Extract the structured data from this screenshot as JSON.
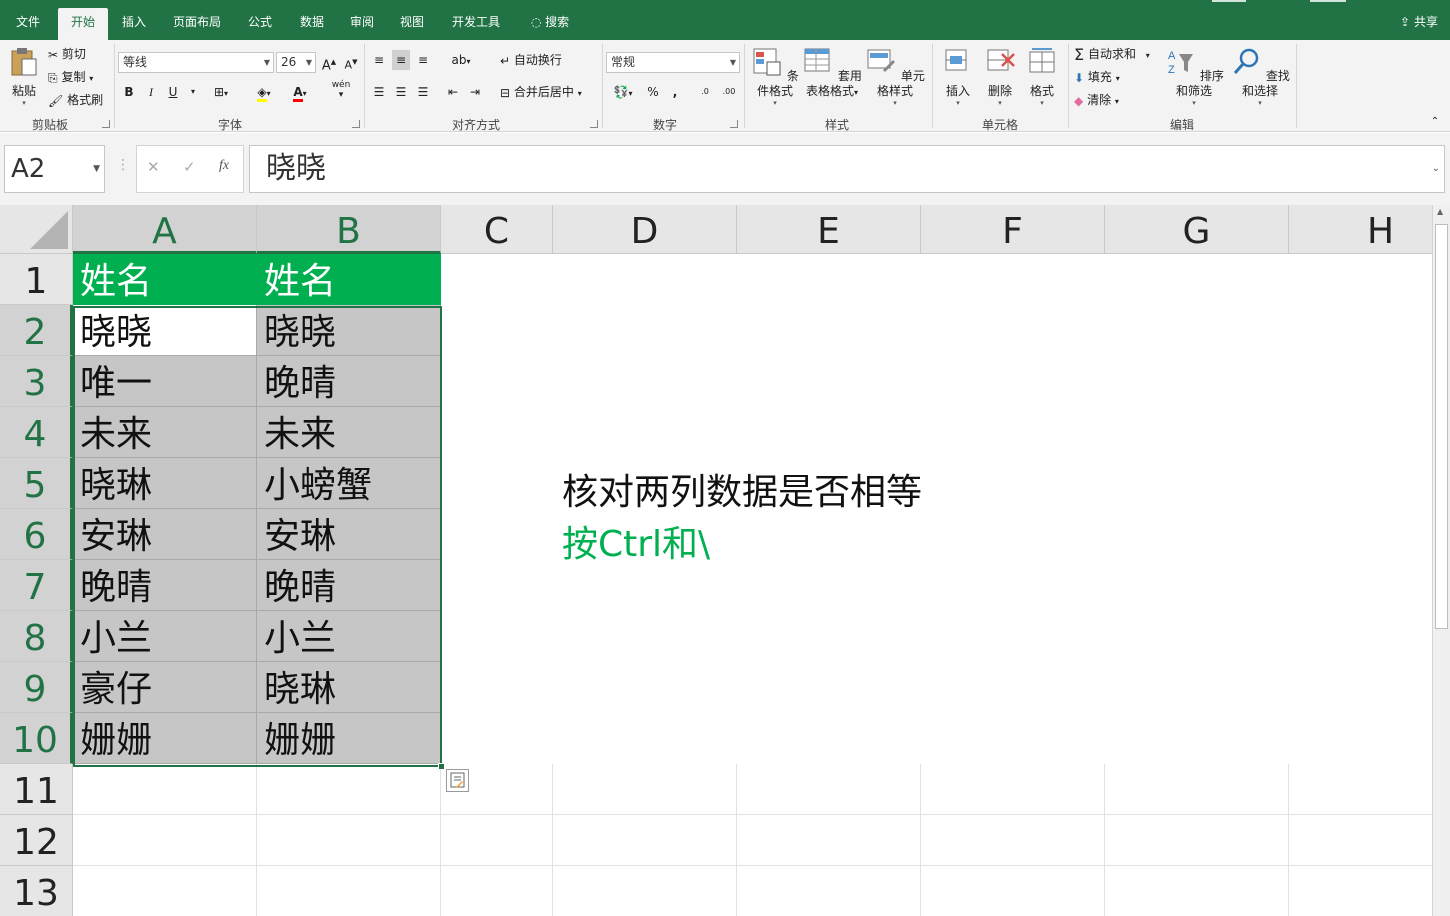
{
  "tabs": [
    "文件",
    "开始",
    "插入",
    "页面布局",
    "公式",
    "数据",
    "审阅",
    "视图",
    "开发工具",
    "搜索"
  ],
  "share_label": "共享",
  "clipboard": {
    "paste": "粘贴",
    "cut": "剪切",
    "copy": "复制",
    "format_painter": "格式刷",
    "group": "剪贴板"
  },
  "font": {
    "name": "等线",
    "size": "26",
    "bold": "B",
    "italic": "I",
    "underline": "U",
    "group": "字体",
    "grow": "A",
    "shrink": "A",
    "wen": "wén"
  },
  "align": {
    "wrap": "自动换行",
    "merge": "合并后居中",
    "group": "对齐方式"
  },
  "number": {
    "format": "常规",
    "percent": "%",
    "comma": ",",
    "inc": ".0",
    "dec": ".00",
    "group": "数字"
  },
  "styles": {
    "conditional": "条件格式",
    "table_l1": "套用",
    "table_l2": "表格格式",
    "cell_styles": "单元格样式",
    "group": "样式"
  },
  "cells": {
    "insert": "插入",
    "delete": "删除",
    "format": "格式",
    "group": "单元格"
  },
  "editing": {
    "autosum": "自动求和",
    "fill": "填充",
    "clear": "清除",
    "sort": "排序和筛选",
    "find": "查找和选择",
    "group": "编辑"
  },
  "formula_bar": {
    "name_box": "A2",
    "cancel": "✕",
    "enter": "✓",
    "fx": "fx",
    "value": "晓晓"
  },
  "columns": [
    "A",
    "B",
    "C",
    "D",
    "E",
    "F",
    "G",
    "H"
  ],
  "rows": [
    "1",
    "2",
    "3",
    "4",
    "5",
    "6",
    "7",
    "8",
    "9",
    "10",
    "11",
    "12",
    "13"
  ],
  "sheet": {
    "col_a": [
      "姓名",
      "晓晓",
      "唯一",
      "未来",
      "晓琳",
      "安琳",
      "晚晴",
      "小兰",
      "豪仔",
      "姗姗"
    ],
    "col_b": [
      "姓名",
      "晓晓",
      "晚晴",
      "未来",
      "小螃蟹",
      "安琳",
      "晚晴",
      "小兰",
      "晓琳",
      "姗姗"
    ]
  },
  "notes": {
    "line1": "核对两列数据是否相等",
    "line2": "按Ctrl和\\"
  },
  "colors": {
    "accent": "#217346",
    "header_fill": "#00b050",
    "selection_fill": "#c6c6c6"
  }
}
